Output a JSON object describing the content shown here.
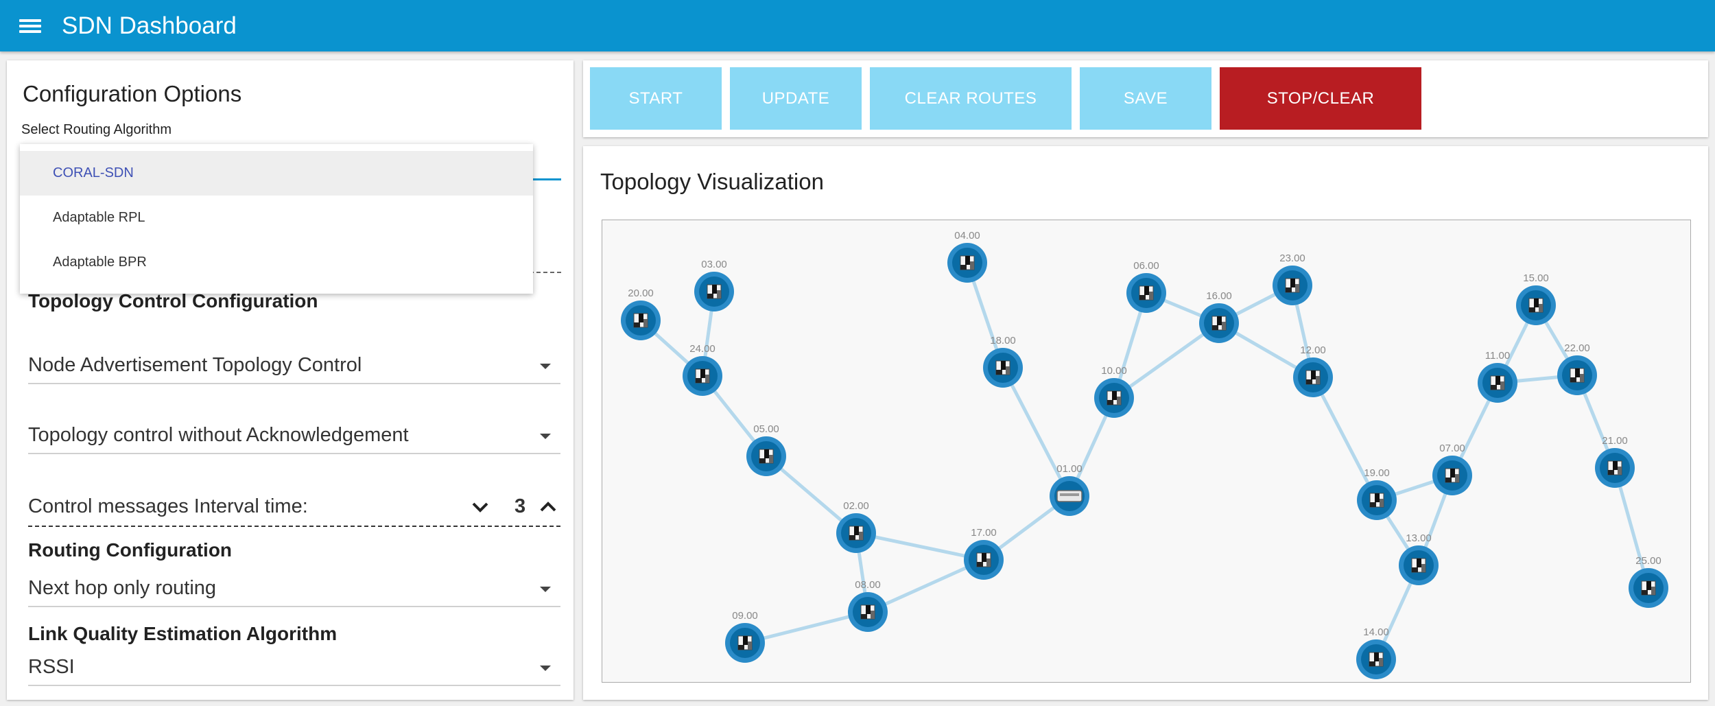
{
  "app": {
    "title": "SDN Dashboard",
    "brand_color": "#0a93cf"
  },
  "config": {
    "title": "Configuration Options",
    "routing_algorithm_label": "Select Routing Algorithm",
    "routing_algorithm_options": [
      {
        "label": "CORAL-SDN",
        "selected": true
      },
      {
        "label": "Adaptable RPL",
        "selected": false
      },
      {
        "label": "Adaptable BPR",
        "selected": false
      }
    ],
    "topology_control": {
      "heading": "Topology Control Configuration",
      "mode": "Node Advertisement Topology Control",
      "ack_mode": "Topology control without Acknowledgement",
      "interval_label": "Control messages Interval time:",
      "interval_value": "3"
    },
    "routing": {
      "heading": "Routing Configuration",
      "mode": "Next hop only routing"
    },
    "link_quality": {
      "heading": "Link Quality Estimation Algorithm",
      "algorithm": "RSSI"
    }
  },
  "toolbar": {
    "start": "START",
    "update": "UPDATE",
    "clear_routes": "CLEAR ROUTES",
    "save": "SAVE",
    "stop_clear": "STOP/CLEAR"
  },
  "topology": {
    "title": "Topology Visualization",
    "sink_node": "01.00",
    "nodes": [
      "01.00",
      "02.00",
      "03.00",
      "04.00",
      "05.00",
      "06.00",
      "07.00",
      "08.00",
      "09.00",
      "10.00",
      "11.00",
      "12.00",
      "13.00",
      "14.00",
      "15.00",
      "16.00",
      "17.00",
      "18.00",
      "19.00",
      "20.00",
      "21.00",
      "22.00",
      "23.00",
      "24.00",
      "25.00"
    ],
    "links": [
      [
        "03.00",
        "24.00"
      ],
      [
        "20.00",
        "24.00"
      ],
      [
        "24.00",
        "05.00"
      ],
      [
        "05.00",
        "02.00"
      ],
      [
        "02.00",
        "08.00"
      ],
      [
        "02.00",
        "17.00"
      ],
      [
        "08.00",
        "09.00"
      ],
      [
        "08.00",
        "17.00"
      ],
      [
        "17.00",
        "01.00"
      ],
      [
        "04.00",
        "18.00"
      ],
      [
        "18.00",
        "01.00"
      ],
      [
        "01.00",
        "10.00"
      ],
      [
        "10.00",
        "06.00"
      ],
      [
        "10.00",
        "16.00"
      ],
      [
        "06.00",
        "16.00"
      ],
      [
        "16.00",
        "23.00"
      ],
      [
        "16.00",
        "12.00"
      ],
      [
        "23.00",
        "12.00"
      ],
      [
        "12.00",
        "19.00"
      ],
      [
        "19.00",
        "13.00"
      ],
      [
        "19.00",
        "07.00"
      ],
      [
        "07.00",
        "13.00"
      ],
      [
        "13.00",
        "14.00"
      ],
      [
        "07.00",
        "11.00"
      ],
      [
        "11.00",
        "15.00"
      ],
      [
        "11.00",
        "22.00"
      ],
      [
        "15.00",
        "22.00"
      ],
      [
        "22.00",
        "21.00"
      ],
      [
        "21.00",
        "25.00"
      ]
    ]
  }
}
